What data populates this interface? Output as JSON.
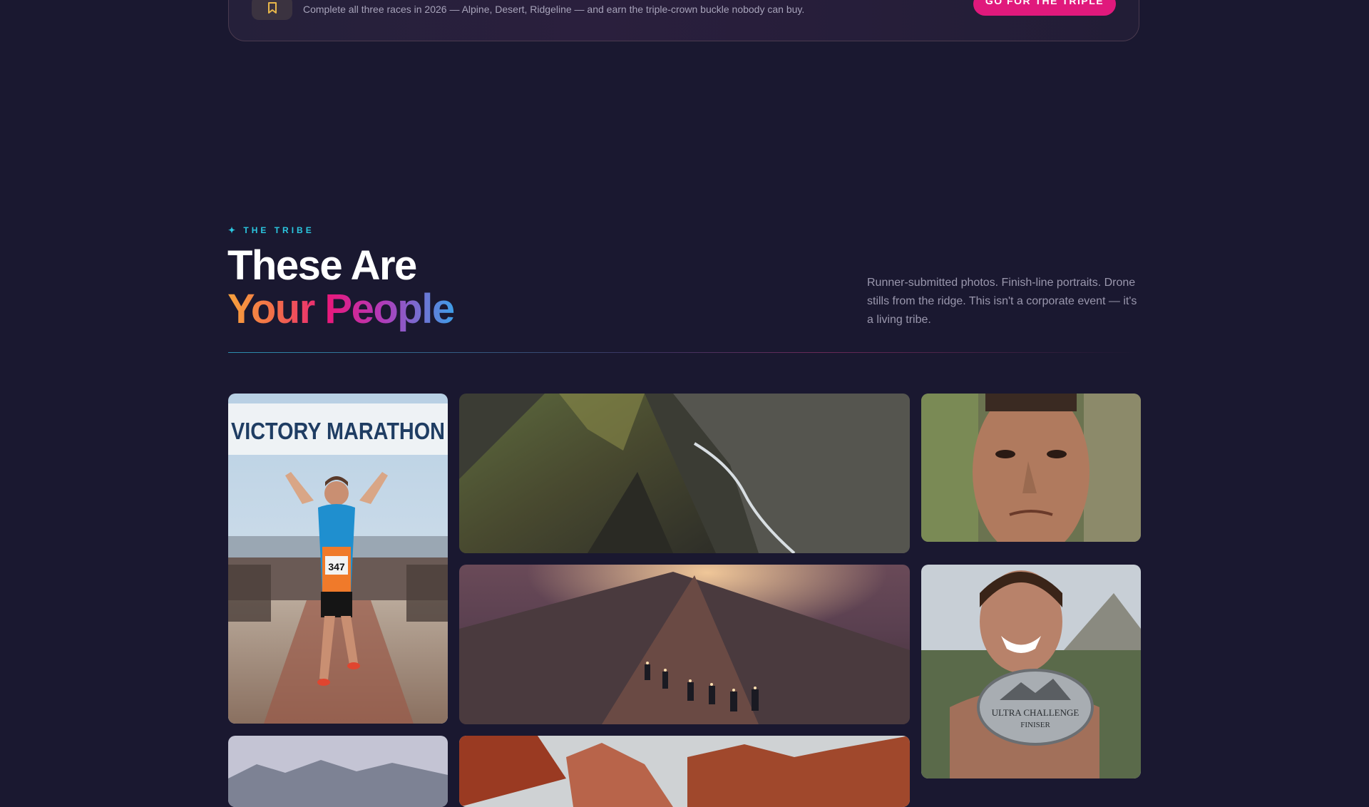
{
  "banner": {
    "icon": "ribbon-badge-icon",
    "text": "Complete all three races in 2026 — Alpine, Desert, Ridgeline — and earn the triple-crown buckle nobody can buy.",
    "cta_label": "GO FOR THE TRIPLE"
  },
  "section": {
    "eyebrow": "✦ THE TRIBE",
    "title_line1": "These Are",
    "title_line2": "Your People",
    "description": "Runner-submitted photos. Finish-line portraits. Drone stills from the ridge. This isn't a corporate event — it's a living tribe."
  },
  "gallery": {
    "finish_banner_text": "VICTORY MARATHON",
    "bib_number": "347",
    "buckle_text_1": "ULTRA CHALLENGE",
    "buckle_text_2": "FINISER",
    "photos": [
      "marathon-finish-photo",
      "mountain-ridge-aerial-photo",
      "sweaty-runner-portrait-photo",
      "night-trail-runners-photo",
      "buckle-finisher-portrait-photo",
      "mountain-range-photo",
      "red-canyon-photo"
    ]
  },
  "colors": {
    "background": "#1a1830",
    "accent_pink": "#e0197c",
    "accent_cyan": "#2bc7e0",
    "gradient": [
      "#f7a23c",
      "#e8197d",
      "#b23ab8",
      "#3d9ee8"
    ]
  }
}
